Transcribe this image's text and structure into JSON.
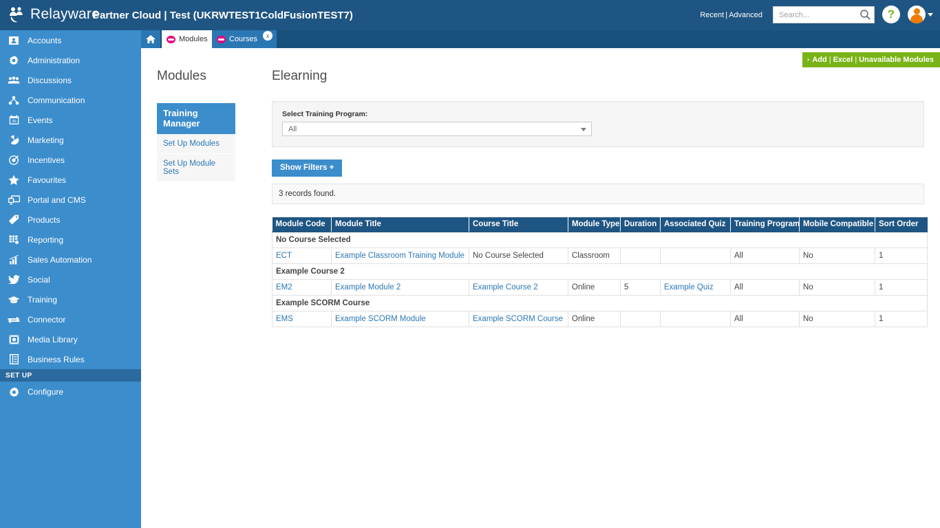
{
  "topbar": {
    "brand": "Relayware",
    "app_title": "Partner Cloud | Test (UKRWTEST1ColdFusionTEST7)",
    "recent_label": "Recent",
    "separator": "|",
    "advanced_label": "Advanced",
    "search_placeholder": "Search...",
    "search_value": "",
    "help_glyph": "?",
    "colors": {
      "topbar_bg": "#1f5582",
      "sidebar_bg": "#3c8dcc",
      "accent_green": "#7ab317",
      "tab_icon_pink": "#e5007d",
      "avatar_orange": "#f07d00",
      "table_header": "#1f5582",
      "link_blue": "#2b77b4"
    }
  },
  "tabs": {
    "collapse_glyph": "«",
    "home_label": "home-tab",
    "items": [
      {
        "label": "Modules",
        "active": true,
        "close_glyph": "x"
      },
      {
        "label": "Courses",
        "active": false,
        "close_glyph": "x"
      }
    ]
  },
  "sidebar": {
    "items": [
      {
        "label": "Accounts",
        "icon": "address-book-icon"
      },
      {
        "label": "Administration",
        "icon": "gear-icon"
      },
      {
        "label": "Discussions",
        "icon": "people-group-icon"
      },
      {
        "label": "Communication",
        "icon": "network-share-icon"
      },
      {
        "label": "Events",
        "icon": "calendar-icon"
      },
      {
        "label": "Marketing",
        "icon": "pie-chart-icon"
      },
      {
        "label": "Incentives",
        "icon": "target-icon"
      },
      {
        "label": "Favourites",
        "icon": "star-icon"
      },
      {
        "label": "Portal and CMS",
        "icon": "monitor-icon"
      },
      {
        "label": "Products",
        "icon": "tag-icon"
      },
      {
        "label": "Reporting",
        "icon": "report-grid-icon"
      },
      {
        "label": "Sales Automation",
        "icon": "bar-chart-icon"
      },
      {
        "label": "Social",
        "icon": "bird-icon"
      },
      {
        "label": "Training",
        "icon": "graduation-cap-icon"
      },
      {
        "label": "Connector",
        "icon": "exchange-arrows-icon"
      },
      {
        "label": "Media Library",
        "icon": "film-icon"
      },
      {
        "label": "Business Rules",
        "icon": "document-rules-icon"
      }
    ],
    "section_label": "SET UP",
    "setup_items": [
      {
        "label": "Configure",
        "icon": "gear-icon"
      }
    ]
  },
  "content": {
    "action_bar": {
      "chevron": "›",
      "add_label": "Add",
      "excel_label": "Excel",
      "unavailable_label": "Unavailable Modules",
      "separator": "|"
    },
    "section_title": "Modules",
    "page_title": "Elearning",
    "subnav": {
      "header": "Training Manager",
      "items": [
        {
          "label": "Set Up Modules"
        },
        {
          "label": "Set Up Module Sets"
        }
      ]
    },
    "filter": {
      "label": "Select Training Program:",
      "selected": "All"
    },
    "show_filters_label": "Show Filters +",
    "records_found": "3 records found.",
    "table": {
      "columns": [
        "Module Code",
        "Module Title",
        "Course Title",
        "Module Type",
        "Duration",
        "Associated Quiz",
        "Training Program",
        "Mobile Compatible",
        "Sort Order"
      ],
      "groups": [
        {
          "group_title": "No Course Selected",
          "rows": [
            {
              "module_code": "ECT",
              "module_title": "Example Classroom Training Module",
              "course_title": "No Course Selected",
              "module_type": "Classroom",
              "duration": "",
              "associated_quiz": "",
              "training_program": "All",
              "mobile_compatible": "No",
              "sort_order": "1"
            }
          ]
        },
        {
          "group_title": "Example Course 2",
          "rows": [
            {
              "module_code": "EM2",
              "module_title": "Example Module 2",
              "course_title": "Example Course 2",
              "module_type": "Online",
              "duration": "5",
              "associated_quiz": "Example Quiz",
              "training_program": "All",
              "mobile_compatible": "No",
              "sort_order": "1"
            }
          ]
        },
        {
          "group_title": "Example SCORM Course",
          "rows": [
            {
              "module_code": "EMS",
              "module_title": "Example SCORM Module",
              "course_title": "Example SCORM Course",
              "module_type": "Online",
              "duration": "",
              "associated_quiz": "",
              "training_program": "All",
              "mobile_compatible": "No",
              "sort_order": "1"
            }
          ]
        }
      ]
    }
  }
}
